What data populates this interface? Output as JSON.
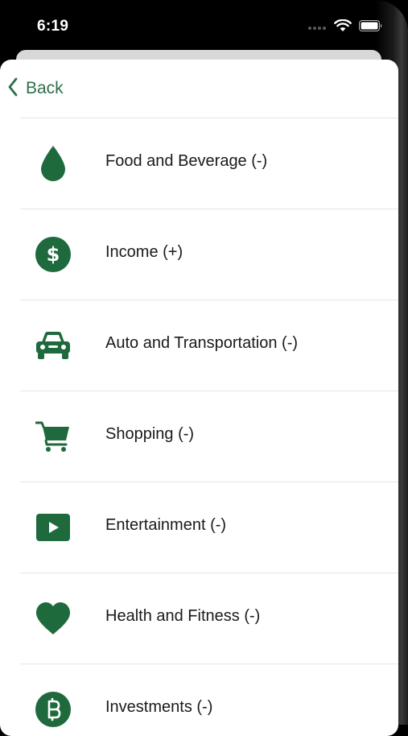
{
  "status_bar": {
    "time": "6:19",
    "icons": [
      "signal-dots-icon",
      "wifi-icon",
      "battery-icon"
    ]
  },
  "nav": {
    "back_label": "Back"
  },
  "theme": {
    "accent": "#1f6a3d",
    "link": "#2e7048",
    "background": "#000000",
    "sheet": "#ffffff"
  },
  "categories": [
    {
      "label": "Food and Beverage (-)",
      "icon": "water-drop-icon"
    },
    {
      "label": "Income (+)",
      "icon": "dollar-icon"
    },
    {
      "label": "Auto and Transportation (-)",
      "icon": "car-icon"
    },
    {
      "label": "Shopping (-)",
      "icon": "cart-icon"
    },
    {
      "label": "Entertainment (-)",
      "icon": "play-icon"
    },
    {
      "label": "Health and Fitness (-)",
      "icon": "heart-icon"
    },
    {
      "label": "Investments (-)",
      "icon": "bitcoin-icon"
    }
  ]
}
